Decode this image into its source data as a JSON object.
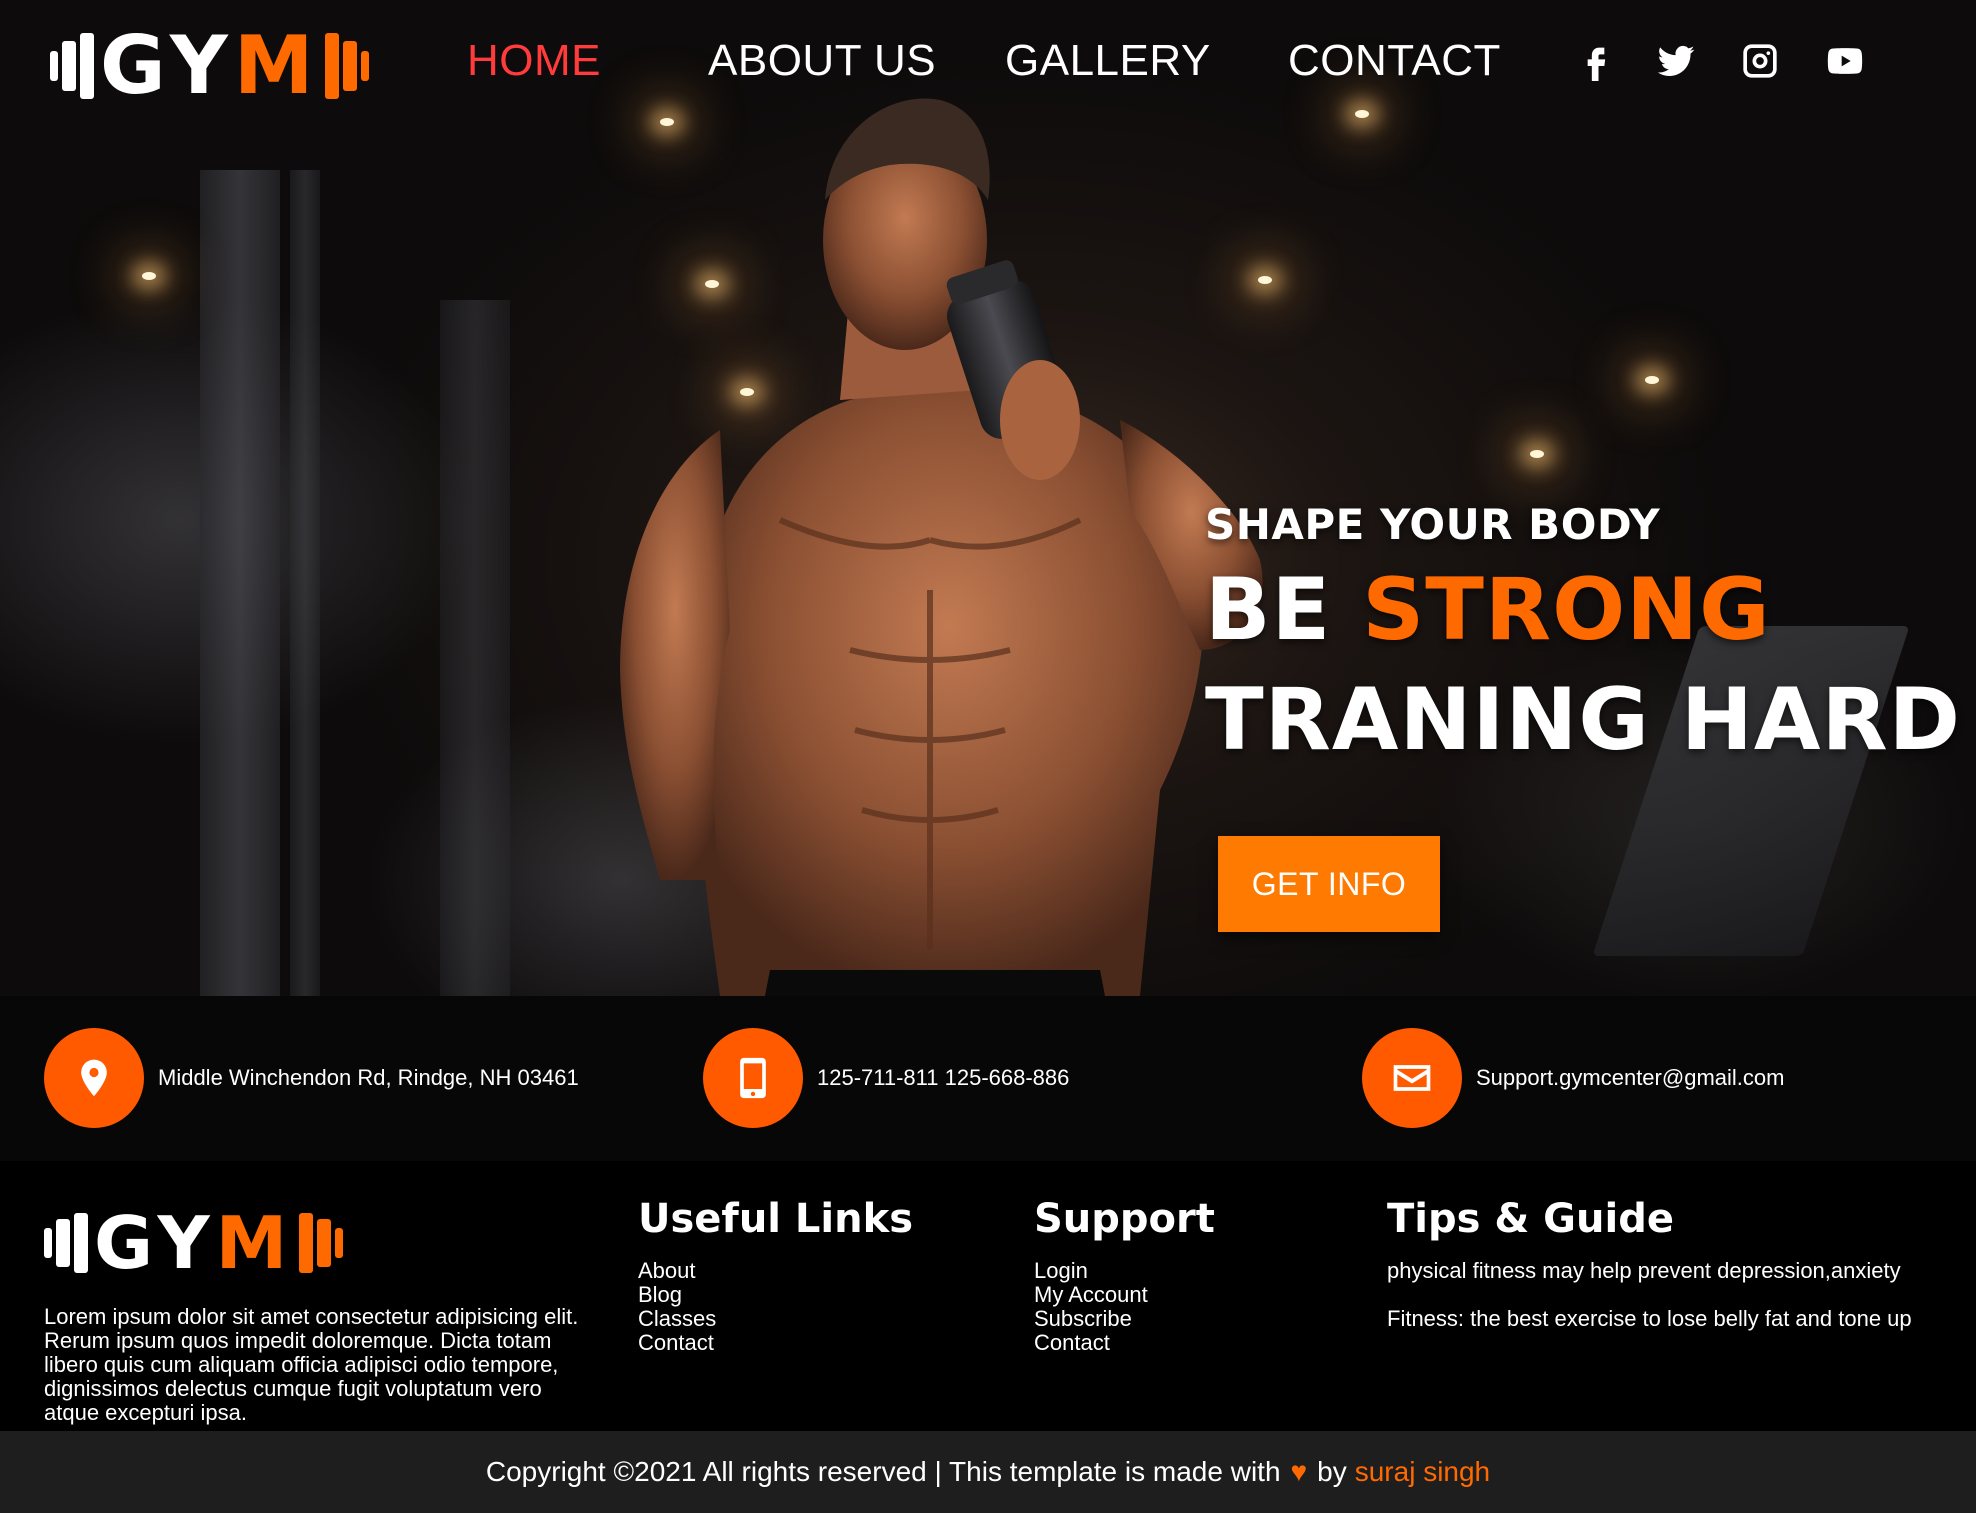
{
  "brand": {
    "logo_white": "GY",
    "logo_orange": "M"
  },
  "nav": {
    "links": [
      {
        "label": "HOME",
        "active": true
      },
      {
        "label": "ABOUT US",
        "active": false
      },
      {
        "label": "GALLERY",
        "active": false
      },
      {
        "label": "CONTACT",
        "active": false
      }
    ],
    "social_icons": [
      "facebook-icon",
      "twitter-icon",
      "instagram-icon",
      "youtube-icon"
    ]
  },
  "hero": {
    "eyebrow": "SHAPE YOUR BODY",
    "line1_white": "BE",
    "line1_accent": "STRONG",
    "line2": "TRANING HARD",
    "cta_label": "GET INFO"
  },
  "contact": {
    "address": "Middle Winchendon Rd, Rindge, NH 03461",
    "phone": "125-711-811 125-668-886",
    "email": "Support.gymcenter@gmail.com",
    "icons": [
      "location-pin-icon",
      "phone-icon",
      "envelope-icon"
    ]
  },
  "footer": {
    "about_text": "Lorem ipsum dolor sit amet consectetur adipisicing elit. Rerum ipsum quos impedit doloremque. Dicta totam libero quis cum aliquam officia adipisci odio tempore, dignissimos delectus cumque fugit voluptatum vero atque excepturi ipsa.",
    "useful_links": {
      "title": "Useful Links",
      "items": [
        "About",
        "Blog",
        "Classes",
        "Contact"
      ]
    },
    "support": {
      "title": "Support",
      "items": [
        "Login",
        "My Account",
        "Subscribe",
        "Contact"
      ]
    },
    "tips": {
      "title": "Tips & Guide",
      "items": [
        "physical fitness may help prevent depression,anxiety",
        "Fitness: the best exercise to lose belly fat and tone up"
      ]
    }
  },
  "copyright": {
    "text": "Copyright ©2021 All rights reserved | This template is made with",
    "heart": "♥",
    "by": "by",
    "author": "suraj singh"
  },
  "colors": {
    "accent": "#ff6a00",
    "active_nav": "#ff3b3b",
    "strip_bg": "#070707",
    "copyright_bg": "#1e1e1e"
  }
}
